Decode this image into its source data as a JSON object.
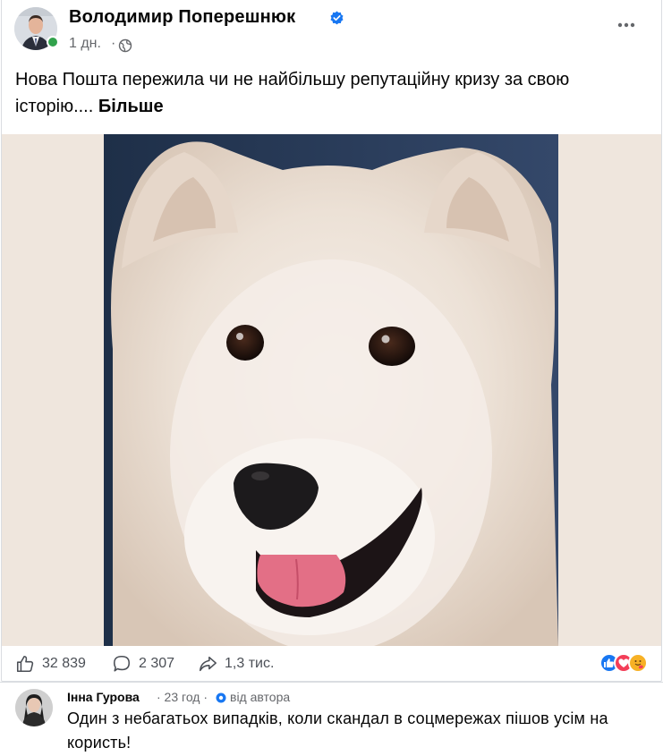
{
  "post": {
    "author": "Володимир Поперешнюк",
    "time": "1 дн.",
    "separator": "·",
    "text": "Нова Пошта пережила чи не найбільшу репутаційну кризу за свою історію....",
    "see_more": "Більше",
    "image_subject": "samoyed-dog-photo"
  },
  "stats": {
    "likes": "32 839",
    "comments": "2 307",
    "shares": "1,3 тис."
  },
  "reactions": [
    "like-icon",
    "love-icon",
    "care-icon"
  ],
  "comment": {
    "author": "Інна Гурова",
    "time": "· 23 год ·",
    "badge": "від автора",
    "text": "Один з небагатьох випадків, коли скандал в соцмережах пішов усім на користь!"
  },
  "colors": {
    "verified": "#1877f2",
    "online": "#31a24c",
    "like": "#1877f2",
    "love": "#f33e58",
    "care": "#f7b125",
    "image_background": "#efe6dd"
  }
}
